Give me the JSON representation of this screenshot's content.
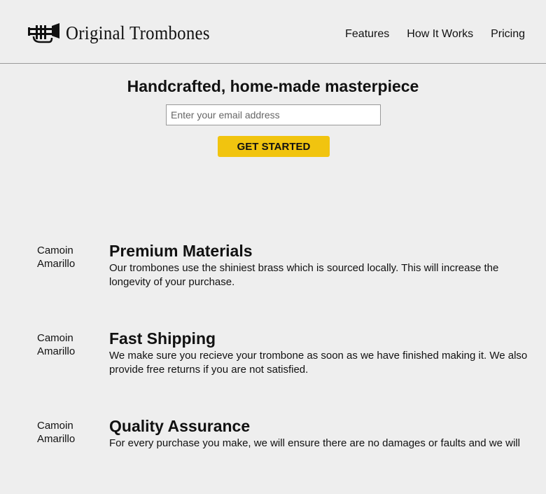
{
  "header": {
    "brand": "Original Trombones",
    "logo_icon": "trombone-icon",
    "nav": [
      {
        "label": "Features"
      },
      {
        "label": "How It Works"
      },
      {
        "label": "Pricing"
      }
    ]
  },
  "hero": {
    "title": "Handcrafted, home-made masterpiece",
    "email_placeholder": "Enter your email address",
    "cta_label": "GET STARTED",
    "cta_color": "#f1c40f"
  },
  "features": [
    {
      "image_alt": "Camoin Amarillo",
      "title": "Premium Materials",
      "description": "Our trombones use the shiniest brass which is sourced locally. This will increase the longevity of your purchase."
    },
    {
      "image_alt": "Camoin Amarillo",
      "title": "Fast Shipping",
      "description": "We make sure you recieve your trombone as soon as we have finished making it. We also provide free returns if you are not satisfied."
    },
    {
      "image_alt": "Camoin Amarillo",
      "title": "Quality Assurance",
      "description": "For every purchase you make, we will ensure there are no damages or faults and we will"
    }
  ]
}
